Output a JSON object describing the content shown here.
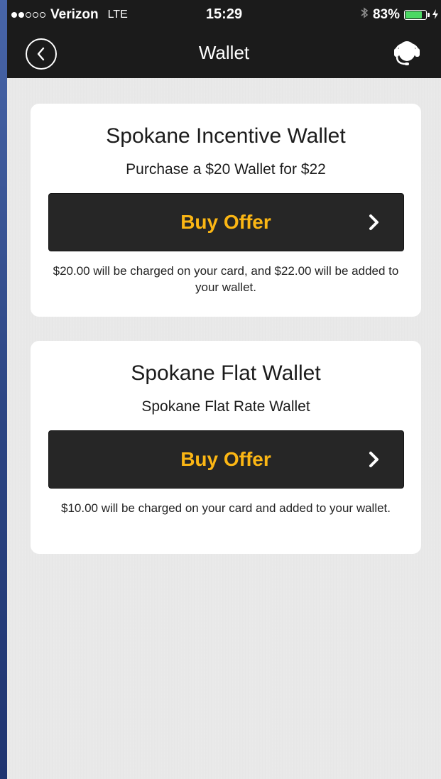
{
  "status_bar": {
    "signal_full": 2,
    "signal_empty": 3,
    "carrier": "Verizon",
    "network": "LTE",
    "time": "15:29",
    "bluetooth_icon": "bluetooth-icon",
    "battery_percent": "83%",
    "battery_level": 0.83,
    "charging_icon": "bolt-icon"
  },
  "nav": {
    "back_icon": "chevron-left-circle-icon",
    "title": "Wallet",
    "support_icon": "headset-icon"
  },
  "offers": [
    {
      "title": "Spokane Incentive Wallet",
      "subtitle": "Purchase a $20 Wallet for $22",
      "button_label": "Buy Offer",
      "note": "$20.00 will be charged on your card, and $22.00 will be added to your wallet."
    },
    {
      "title": "Spokane Flat Wallet",
      "subtitle": "Spokane Flat Rate Wallet",
      "button_label": "Buy Offer",
      "note": "$10.00 will be charged on your card and added to your wallet."
    }
  ],
  "colors": {
    "button_text": "#fbb614",
    "battery_fill": "#4cd964",
    "bar_background": "#1b1b1b"
  }
}
